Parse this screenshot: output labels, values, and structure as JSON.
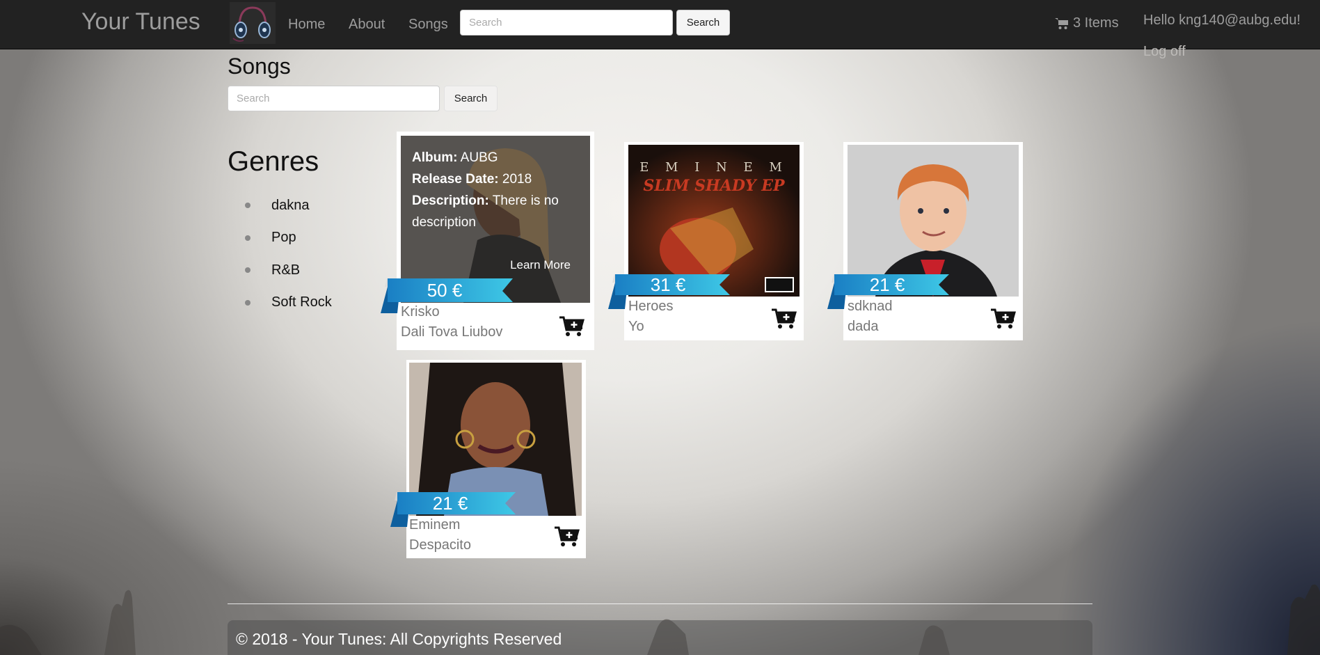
{
  "navbar": {
    "brand": "Your Tunes",
    "links": [
      {
        "label": "Home"
      },
      {
        "label": "About"
      },
      {
        "label": "Songs"
      }
    ],
    "search": {
      "placeholder": "Search",
      "button_label": "Search"
    },
    "cart_label": "3 Items",
    "greeting": "Hello kng140@aubg.edu!",
    "logoff_label": "Log off"
  },
  "page": {
    "title": "Songs",
    "search": {
      "placeholder": "Search",
      "button_label": "Search"
    }
  },
  "genres": {
    "title": "Genres",
    "items": [
      "dakna",
      "Pop",
      "R&B",
      "Soft Rock"
    ]
  },
  "songs": [
    {
      "price": "50 €",
      "artist": "Krisko",
      "title": "Dali Tova Liubov",
      "overlay": {
        "album_label": "Album:",
        "album": "AUBG",
        "release_label": "Release Date:",
        "release": "2018",
        "description_label": "Description:",
        "description": "There is no description",
        "learn_more": "Learn More"
      }
    },
    {
      "price": "31 €",
      "artist": "Heroes",
      "title": "Yo",
      "cover_text_1": "E M I N E M",
      "cover_text_2": "SLIM SHADY EP"
    },
    {
      "price": "21 €",
      "artist": "sdknad",
      "title": "dada"
    },
    {
      "price": "21 €",
      "artist": "Eminem",
      "title": "Despacito"
    }
  ],
  "footer": {
    "text": "© 2018 - Your Tunes: All Copyrights Reserved"
  },
  "colors": {
    "navbar": "#222222",
    "ribbon_light": "#3ec8e6",
    "ribbon_dark": "#1a7fc4"
  }
}
